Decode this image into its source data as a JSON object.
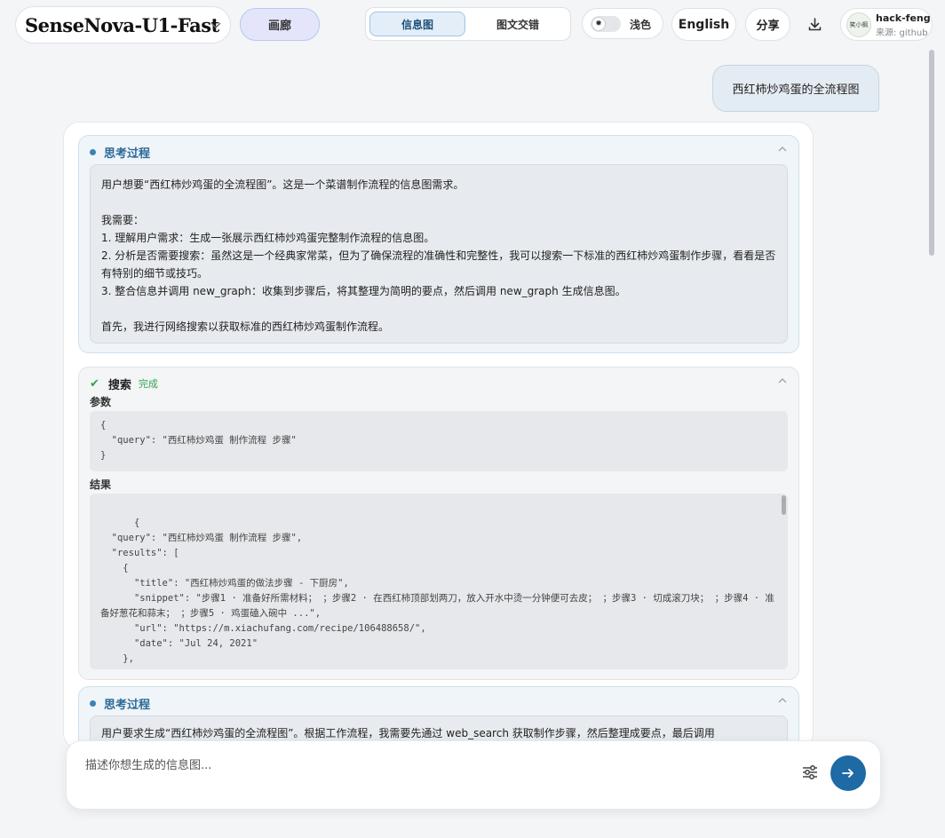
{
  "header": {
    "model_name": "SenseNova-U1-Fast",
    "gallery_label": "画廊",
    "tabs": [
      {
        "label": "信息图",
        "active": true
      },
      {
        "label": "图文交错",
        "active": false
      }
    ],
    "theme_label": "浅色",
    "language_label": "English",
    "share_label": "分享",
    "user": {
      "name": "hack-feng",
      "source": "来源: github",
      "avatar_text": "笑小枫"
    }
  },
  "user_message": "西红柿炒鸡蛋的全流程图",
  "thinking1": {
    "title": "思考过程",
    "lines": [
      "用户想要“西红柿炒鸡蛋的全流程图”。这是一个菜谱制作流程的信息图需求。",
      "",
      "我需要：",
      "1. 理解用户需求：生成一张展示西红柿炒鸡蛋完整制作流程的信息图。",
      "2. 分析是否需要搜索：虽然这是一个经典家常菜，但为了确保流程的准确性和完整性，我可以搜索一下标准的西红柿炒鸡蛋制作步骤，看看是否有特别的细节或技巧。",
      "3. 整合信息并调用 new_graph：收集到步骤后，将其整理为简明的要点，然后调用 new_graph 生成信息图。",
      "",
      "首先，我进行网络搜索以获取标准的西红柿炒鸡蛋制作流程。"
    ]
  },
  "search": {
    "title": "搜索",
    "status": "完成",
    "params_label": "参数",
    "params_text": "{\n  \"query\": \"西红柿炒鸡蛋 制作流程 步骤\"\n}",
    "results_label": "结果",
    "results_text": "{\n  \"query\": \"西红柿炒鸡蛋 制作流程 步骤\",\n  \"results\": [\n    {\n      \"title\": \"西红柿炒鸡蛋的做法步骤 - 下厨房\",\n      \"snippet\": \"步骤1 · 准备好所需材料； ；步骤2 · 在西红柿顶部划两刀，放入开水中烫一分钟便可去皮； ；步骤3 · 切成滚刀块； ；步骤4 · 准备好葱花和蒜末； ；步骤5 · 鸡蛋磕入碗中 ...\",\n      \"url\": \"https://m.xiachufang.com/recipe/106488658/\",\n      \"date\": \"Jul 24, 2021\"\n    },\n    {"
  },
  "thinking2": {
    "title": "思考过程",
    "preview": "用户要求生成“西红柿炒鸡蛋的全流程图”。根据工作流程，我需要先通过 web_search 获取制作步骤，然后整理成要点，最后调用"
  },
  "composer": {
    "placeholder": "描述你想生成的信息图..."
  },
  "colors": {
    "accent": "#1d6aa4",
    "success": "#2fa44f"
  }
}
